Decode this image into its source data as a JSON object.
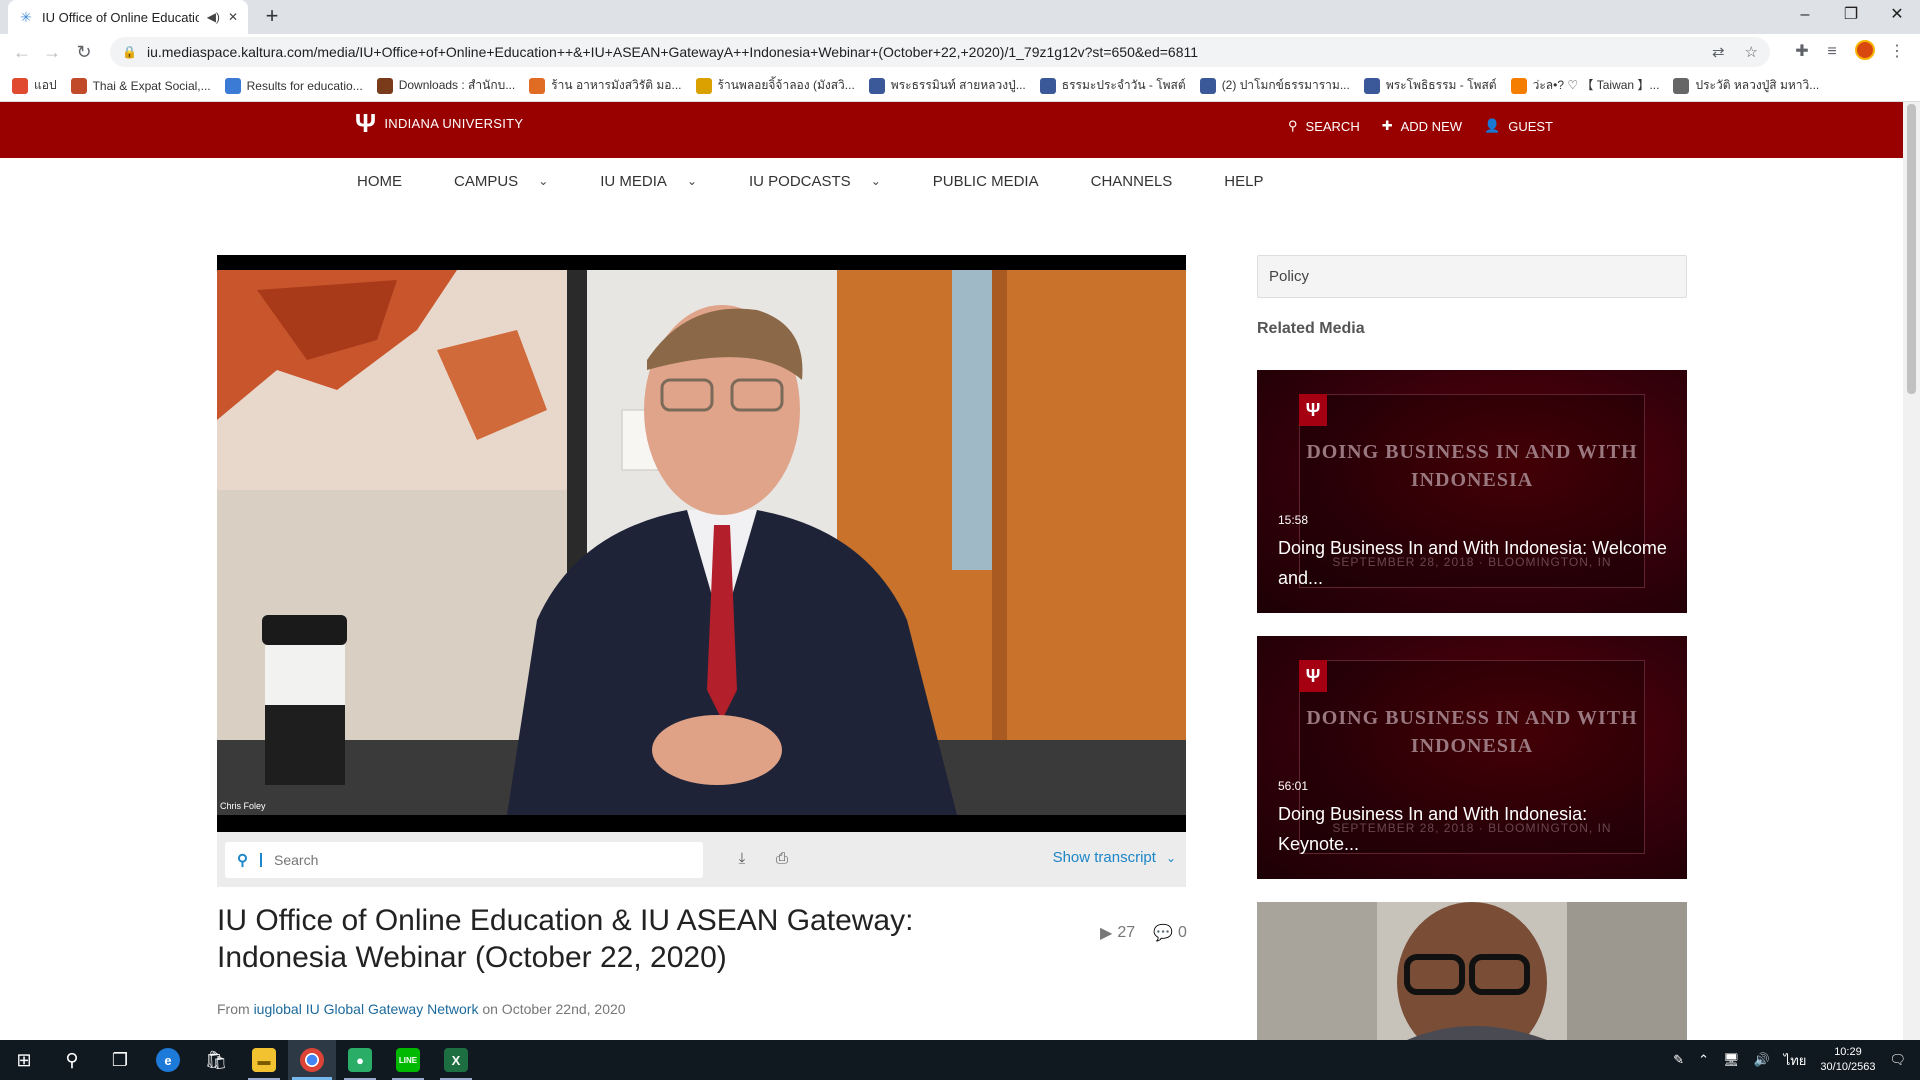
{
  "browser": {
    "tab_title": "IU Office of Online Education",
    "url": "iu.mediaspace.kaltura.com/media/IU+Office+of+Online+Education++&+IU+ASEAN+GatewayA++Indonesia+Webinar+(October+22,+2020)/1_79z1g12v?st=650&ed=6811",
    "bookmarks": [
      {
        "label": "แอป",
        "icon": "apps-grid-icon",
        "color": "#e04a2f"
      },
      {
        "label": "Thai & Expat Social,...",
        "icon": "bookmark-icon",
        "color": "#c04a2a"
      },
      {
        "label": "Results for educatio...",
        "icon": "diamond-icon",
        "color": "#3b7bd6"
      },
      {
        "label": "Downloads : สำนักบ...",
        "icon": "seal-icon",
        "color": "#7a3b1b"
      },
      {
        "label": "ร้าน อาหารมังสวิรัติ มอ...",
        "icon": "shop-icon",
        "color": "#e06b22"
      },
      {
        "label": "ร้านพลอยจิ้จ้าลอง (มังสวิ...",
        "icon": "smile-icon",
        "color": "#d9a000"
      },
      {
        "label": "พระธรรมินท์ สายหลวงปู่...",
        "icon": "facebook-icon",
        "color": "#3b5998"
      },
      {
        "label": "ธรรมะประจำวัน - โพสต์",
        "icon": "facebook-icon",
        "color": "#3b5998"
      },
      {
        "label": "(2) ปาโมกข์ธรรมาราม...",
        "icon": "facebook-icon",
        "color": "#3b5998"
      },
      {
        "label": "พระโพธิธรรม - โพสต์",
        "icon": "facebook-icon",
        "color": "#3b5998"
      },
      {
        "label": "ว่ะล•? ♡ 【 Taiwan 】...",
        "icon": "blogger-icon",
        "color": "#f57d00"
      },
      {
        "label": "ประวัติ หลวงปู่สิ มหาวิ...",
        "icon": "globe-icon",
        "color": "#666666"
      }
    ]
  },
  "header": {
    "brand": "INDIANA UNIVERSITY",
    "search": "SEARCH",
    "add_new": "ADD NEW",
    "guest": "GUEST",
    "color": "#990000"
  },
  "nav": [
    "HOME",
    "CAMPUS",
    "IU MEDIA",
    "IU PODCASTS",
    "PUBLIC MEDIA",
    "CHANNELS",
    "HELP"
  ],
  "player": {
    "speaker_caption": "Chris Foley",
    "search_placeholder": "Search",
    "show_transcript": "Show transcript"
  },
  "media": {
    "title": "IU Office of Online Education & IU ASEAN Gateway: Indonesia Webinar (October 22, 2020)",
    "plays": "27",
    "comments": "0",
    "from_prefix": "From",
    "owner": "iuglobal IU Global Gateway Network",
    "date_text": "on October 22nd, 2020"
  },
  "sidebar": {
    "policy": "Policy",
    "related_heading": "Related Media",
    "related": [
      {
        "duration": "15:58",
        "title": "Doing Business In and With Indonesia: Welcome and...",
        "thumb_line1": "DOING BUSINESS IN AND WITH",
        "thumb_line2": "INDONESIA",
        "thumb_sub": "SEPTEMBER 28, 2018 · BLOOMINGTON, IN"
      },
      {
        "duration": "56:01",
        "title": "Doing Business In and With Indonesia: Keynote...",
        "thumb_line1": "DOING BUSINESS IN AND WITH",
        "thumb_line2": "INDONESIA",
        "thumb_sub": "SEPTEMBER 28, 2018 · BLOOMINGTON, IN"
      }
    ]
  },
  "taskbar": {
    "time": "10:29",
    "date": "30/10/2563",
    "lang": "ไทย"
  }
}
